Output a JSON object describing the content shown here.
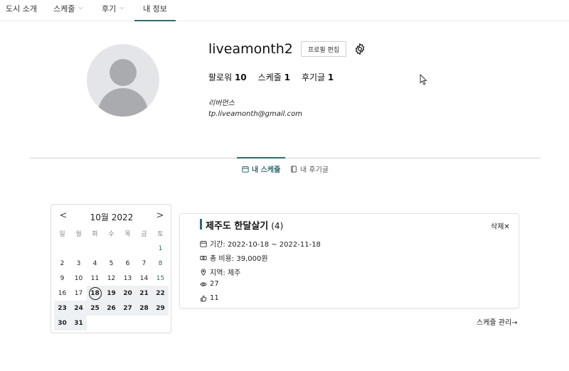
{
  "nav": {
    "items": [
      {
        "label": "도시 소개",
        "has_dropdown": false,
        "active": false
      },
      {
        "label": "스케줄",
        "has_dropdown": true,
        "active": false
      },
      {
        "label": "후기",
        "has_dropdown": true,
        "active": false
      },
      {
        "label": "내 정보",
        "has_dropdown": false,
        "active": true
      }
    ]
  },
  "profile": {
    "username": "liveamonth2",
    "edit_label": "프로필 편집",
    "stats": {
      "followers_label": "팔로워",
      "followers": "10",
      "schedules_label": "스케줄",
      "schedules": "1",
      "reviews_label": "후기글",
      "reviews": "1"
    },
    "bio": "리버먼스",
    "email": "tp.liveamonth@gmail.com"
  },
  "tabs": {
    "my_schedule": "내 스케줄",
    "my_review": "내 후기글"
  },
  "calendar": {
    "title": "10월 2022",
    "prev": "<",
    "next": ">",
    "weekdays": [
      "일",
      "월",
      "화",
      "수",
      "목",
      "금",
      "토"
    ],
    "weeks": [
      [
        "",
        "",
        "",
        "",
        "",
        "",
        "1"
      ],
      [
        "2",
        "3",
        "4",
        "5",
        "6",
        "7",
        "8"
      ],
      [
        "9",
        "10",
        "11",
        "12",
        "13",
        "14",
        "15"
      ],
      [
        "16",
        "17",
        "18",
        "19",
        "20",
        "21",
        "22"
      ],
      [
        "23",
        "24",
        "25",
        "26",
        "27",
        "28",
        "29"
      ],
      [
        "30",
        "31",
        "",
        "",
        "",
        "",
        ""
      ]
    ],
    "range_start": 18,
    "range_end": 31
  },
  "schedule_card": {
    "title": "제주도 한달살기",
    "count": "(4)",
    "delete_label": "삭제✕",
    "period": "기간: 2022-10-18 ~ 2022-11-18",
    "cost": "총 비용: 39,000원",
    "region": "지역: 제주",
    "views": "27",
    "likes": "11"
  },
  "manage_link": "스케줄 관리→",
  "colors": {
    "accent": "#2f6b6e",
    "range_bg": "#eef1f3"
  }
}
